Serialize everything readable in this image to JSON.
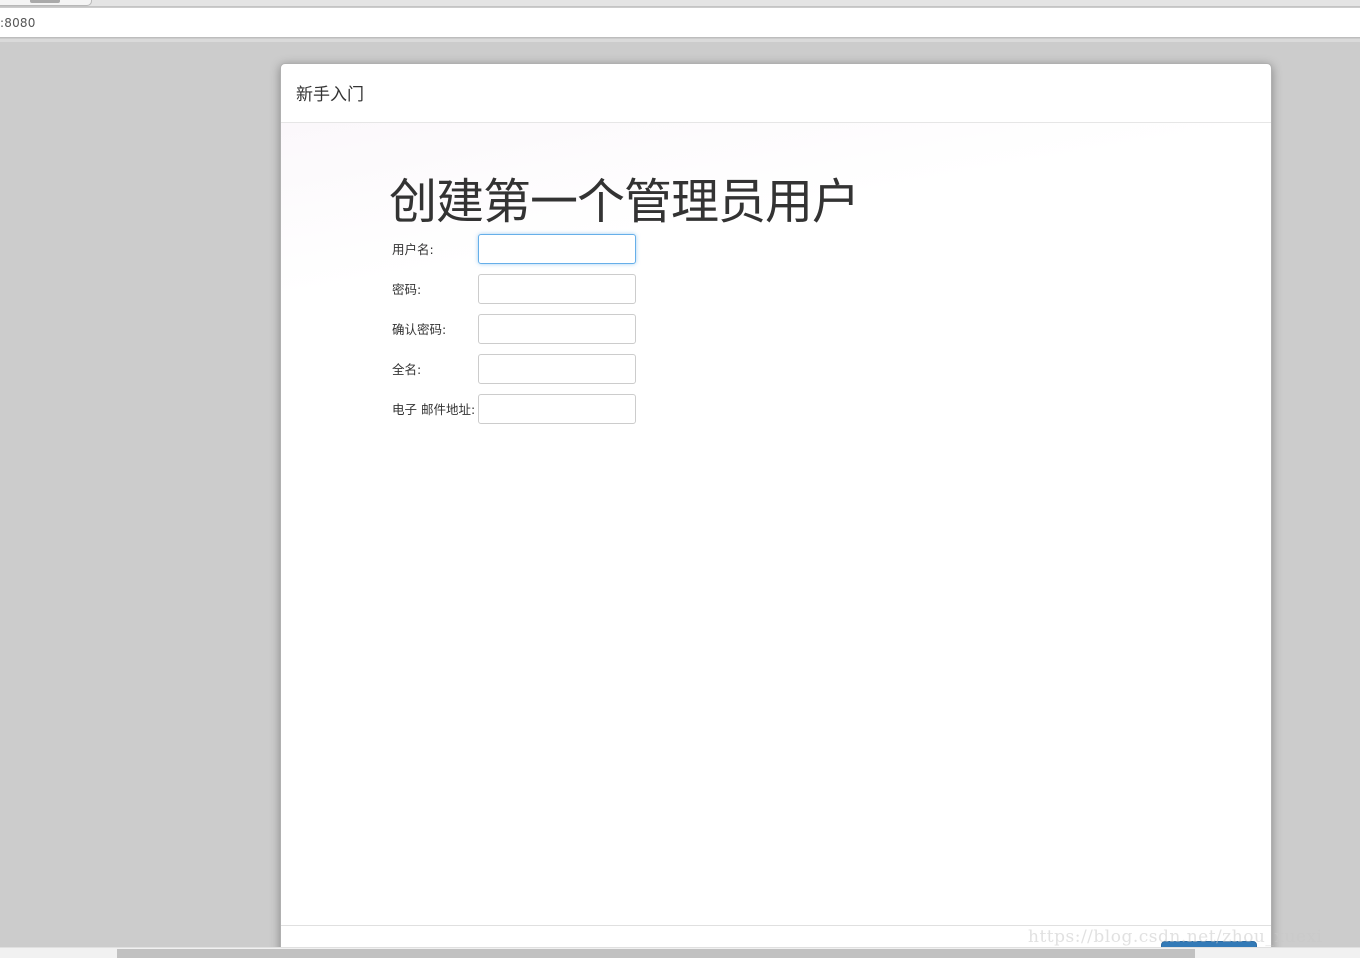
{
  "browser": {
    "address": ":8080"
  },
  "dialog": {
    "title": "新手入门",
    "heading": "创建第一个管理员用户",
    "fields": [
      {
        "label": "用户名:",
        "value": ""
      },
      {
        "label": "密码:",
        "value": ""
      },
      {
        "label": "确认密码:",
        "value": ""
      },
      {
        "label": "全名:",
        "value": ""
      },
      {
        "label": "电子 邮件地址:",
        "value": ""
      }
    ]
  },
  "watermark": "https://blog.csdn.net/zhou_xuexi",
  "colors": {
    "backdrop": "#cccccc",
    "primary_button": "#337ab7",
    "focus_border": "#66afe9"
  }
}
